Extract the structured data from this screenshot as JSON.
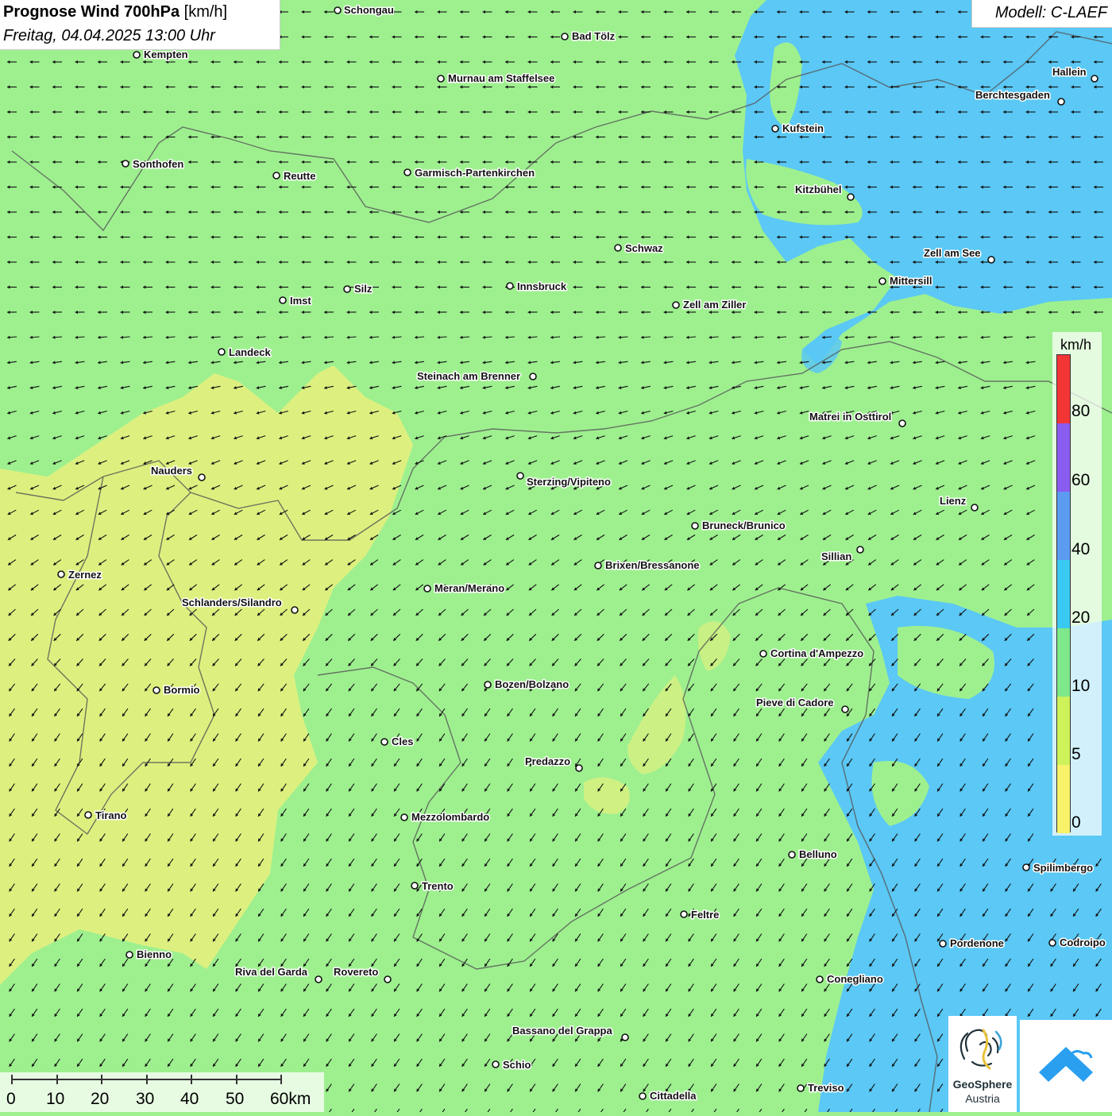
{
  "title": {
    "main": "Prognose Wind 700hPa",
    "unit": "[km/h]",
    "datetime": "Freitag, 04.04.2025 13:00 Uhr"
  },
  "model": "Modell: C-LAEF",
  "legend": {
    "unit": "km/h",
    "ticks": [
      "80",
      "60",
      "40",
      "20",
      "10",
      "5",
      "0"
    ],
    "colors": [
      "#f23636",
      "#8b5cf0",
      "#5b9bf0",
      "#39c9f2",
      "#7fe88a",
      "#cdf25a",
      "#f7f26a"
    ]
  },
  "colors": {
    "calm": "#f2f07a",
    "light": "#9ef08f",
    "moderate": "#5bc8f5"
  },
  "scale": {
    "labels": [
      "0",
      "10",
      "20",
      "30",
      "40",
      "50",
      "60km"
    ]
  },
  "logos": {
    "geosphere_line1": "GeoSphere",
    "geosphere_line2": "Austria"
  },
  "cities": [
    {
      "name": "Schongau"
    },
    {
      "name": "Bad Tölz"
    },
    {
      "name": "Kempten"
    },
    {
      "name": "Murnau am Staffelsee"
    },
    {
      "name": "Hallein"
    },
    {
      "name": "Berchtesgaden"
    },
    {
      "name": "Kufstein"
    },
    {
      "name": "Sonthofen"
    },
    {
      "name": "Reutte"
    },
    {
      "name": "Garmisch-Partenkirchen"
    },
    {
      "name": "Kitzbühel"
    },
    {
      "name": "Schwaz"
    },
    {
      "name": "Zell am See"
    },
    {
      "name": "Mittersill"
    },
    {
      "name": "Imst"
    },
    {
      "name": "Silz"
    },
    {
      "name": "Innsbruck"
    },
    {
      "name": "Zell am Ziller"
    },
    {
      "name": "Landeck"
    },
    {
      "name": "Steinach am Brenner"
    },
    {
      "name": "Matrei in Osttirol"
    },
    {
      "name": "Nauders"
    },
    {
      "name": "Sterzing/Vipiteno"
    },
    {
      "name": "Lienz"
    },
    {
      "name": "Bruneck/Brunico"
    },
    {
      "name": "Sillian"
    },
    {
      "name": "Brixen/Bressanone"
    },
    {
      "name": "Zernez"
    },
    {
      "name": "Meran/Merano"
    },
    {
      "name": "Schlanders/Silandro"
    },
    {
      "name": "Cortina d'Ampezzo"
    },
    {
      "name": "Bozen/Bolzano"
    },
    {
      "name": "Bormio"
    },
    {
      "name": "Pieve di Cadore"
    },
    {
      "name": "Cles"
    },
    {
      "name": "Predazzo"
    },
    {
      "name": "Tirano"
    },
    {
      "name": "Mezzolombardo"
    },
    {
      "name": "Belluno"
    },
    {
      "name": "Spilimbergo"
    },
    {
      "name": "Trento"
    },
    {
      "name": "Feltre"
    },
    {
      "name": "Pordenone"
    },
    {
      "name": "Codroipo"
    },
    {
      "name": "Bienno"
    },
    {
      "name": "Riva del Garda"
    },
    {
      "name": "Rovereto"
    },
    {
      "name": "Conegliano"
    },
    {
      "name": "Bassano del Grappa"
    },
    {
      "name": "Schio"
    },
    {
      "name": "Treviso"
    },
    {
      "name": "Cittadella"
    }
  ]
}
